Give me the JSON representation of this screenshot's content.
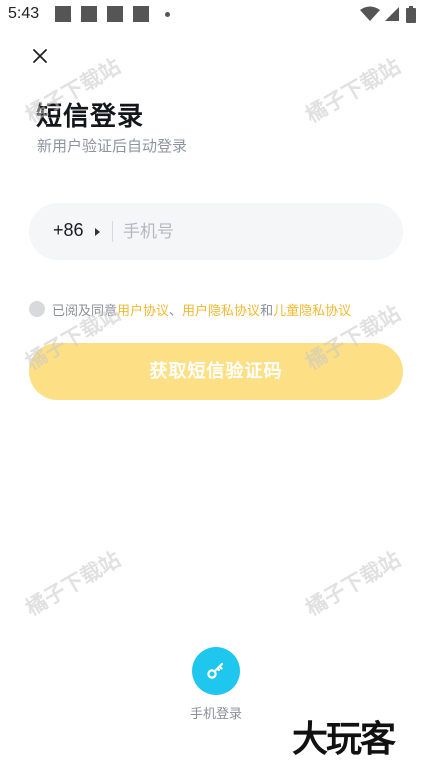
{
  "status_bar": {
    "time": "5:43"
  },
  "login": {
    "title": "短信登录",
    "subtitle": "新用户验证后自动登录",
    "country_code": "+86",
    "phone_placeholder": "手机号",
    "agreement": {
      "prefix": "已阅及同意",
      "user_agreement": "用户协议",
      "separator": "、",
      "privacy_agreement": "用户隐私协议",
      "conjunction": "和",
      "child_privacy": "儿童隐私协议"
    },
    "submit_label": "获取短信验证码",
    "alt_login_label": "手机登录"
  },
  "watermark_text": "橘子下载站",
  "brand_logo": "大玩客",
  "colors": {
    "accent": "#f5b82e",
    "button_disabled": "#fde085",
    "alt_login_circle": "#1fc6ee",
    "input_bg": "#f5f6f8"
  },
  "icons": {
    "close": "close-icon",
    "key": "key-icon",
    "wifi": "wifi-icon",
    "signal": "signal-icon",
    "battery": "battery-icon"
  }
}
